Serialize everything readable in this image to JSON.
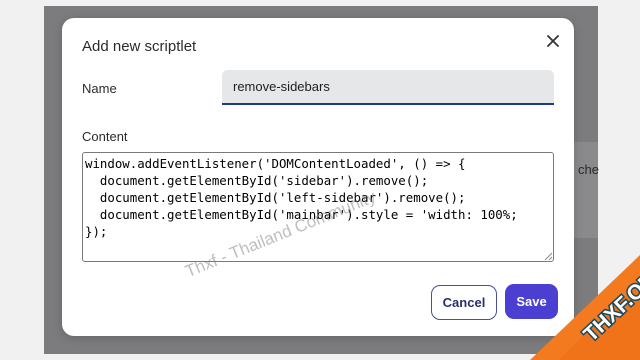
{
  "background": {
    "partial_text": "che"
  },
  "dialog": {
    "title": "Add new scriptlet",
    "close_icon": "close-icon",
    "name_label": "Name",
    "name_value": "remove-sidebars",
    "content_label": "Content",
    "content_value": "window.addEventListener('DOMContentLoaded', () => {\n  document.getElementById('sidebar').remove();\n  document.getElementById('left-sidebar').remove();\n  document.getElementById('mainbar').style = 'width: 100%;\n});",
    "cancel_label": "Cancel",
    "save_label": "Save"
  },
  "watermark": "Thxf - Thailand Community",
  "logo": {
    "text": "THXF.ORG"
  },
  "colors": {
    "accent": "#4a3fd0",
    "cancel_border": "#48508f",
    "input_underline": "#1b3c8b",
    "logo_orange": "#f47a20",
    "logo_teal": "#1c4a5c"
  }
}
